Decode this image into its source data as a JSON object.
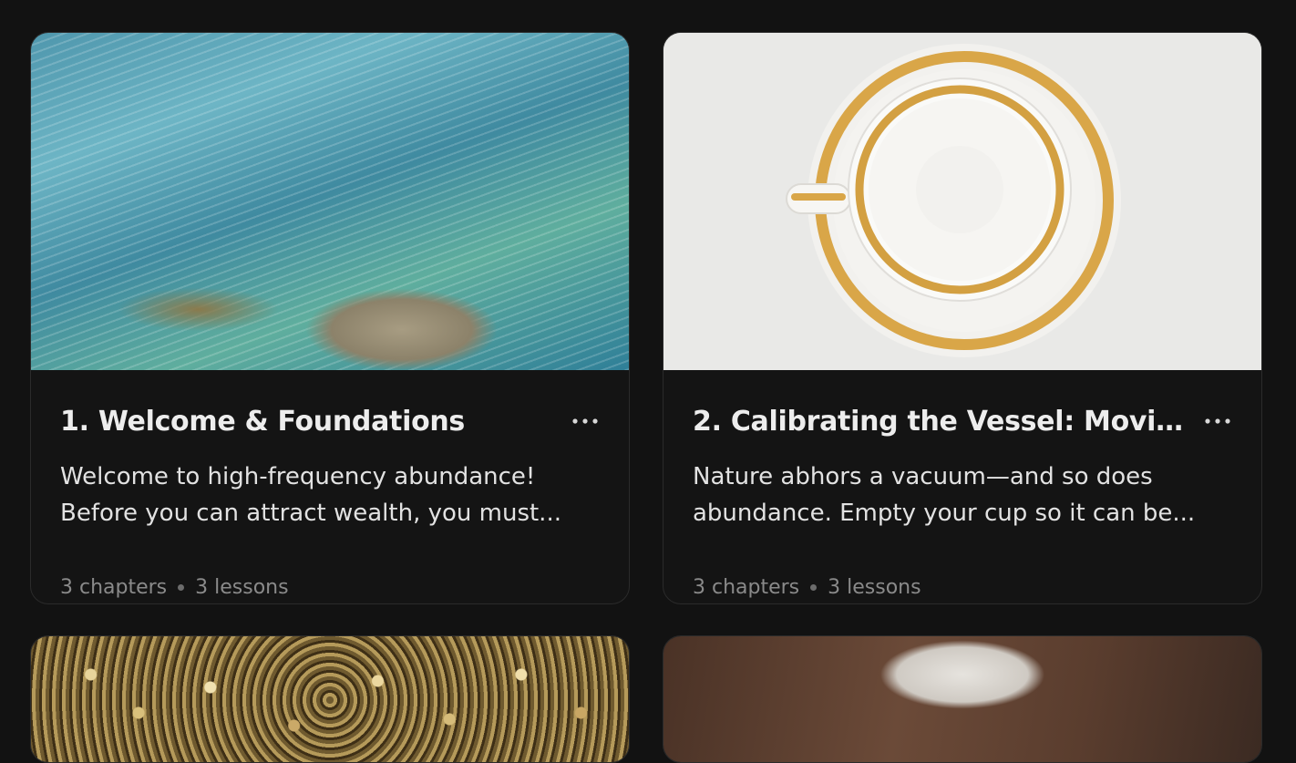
{
  "modules": [
    {
      "title": "1. Welcome & Foundations",
      "description": "Welcome to high-frequency abundance! Before you can attract wealth, you must...",
      "chapters": "3 chapters",
      "lessons": "3 lessons",
      "cover_icon": "water-rocks-image"
    },
    {
      "title": "2. Calibrating the Vessel: Moving ...",
      "description": "Nature abhors a vacuum—and so does abundance. Empty your cup so it can be...",
      "chapters": "3 chapters",
      "lessons": "3 lessons",
      "cover_icon": "teacup-image"
    },
    {
      "cover_icon": "coins-image"
    },
    {
      "cover_icon": "desk-writing-image"
    }
  ],
  "more_icon": "more-horizontal-icon",
  "colors": {
    "background": "#121212",
    "card": "#141414",
    "card_border": "#2b2b2b",
    "title": "#ededed",
    "meta": "#8a8a8a"
  }
}
